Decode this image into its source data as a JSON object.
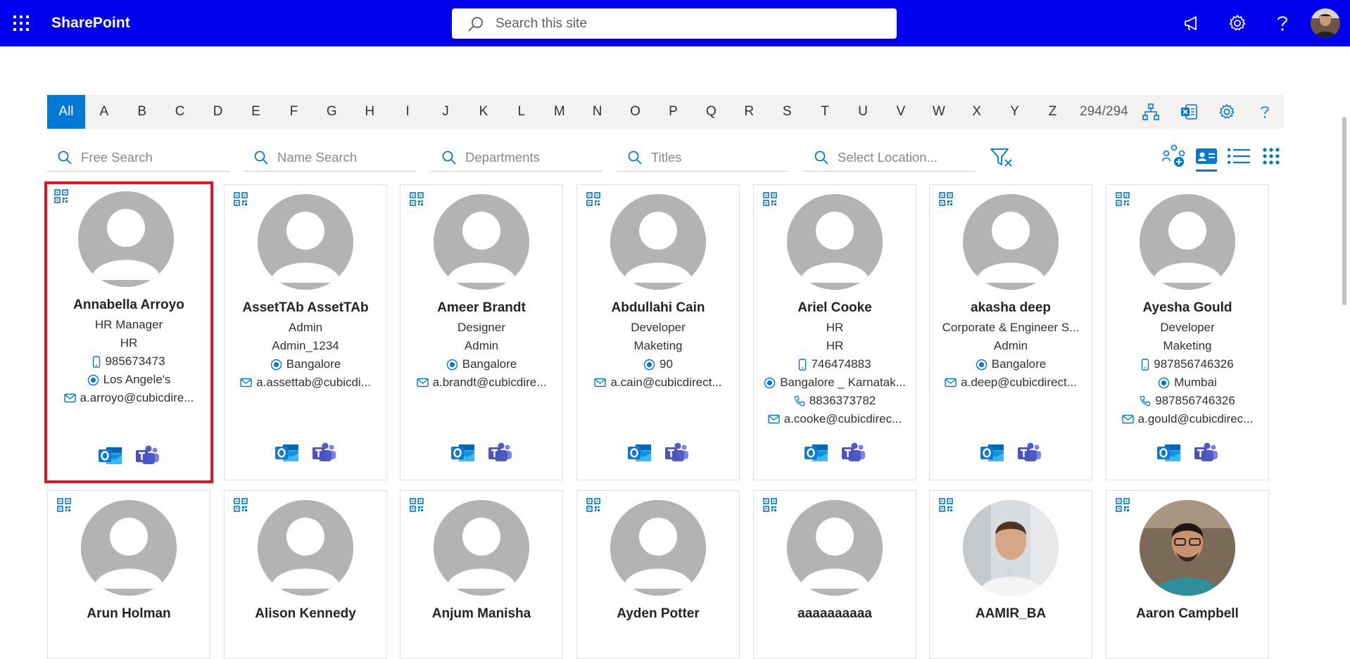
{
  "suite": {
    "brand": "SharePoint",
    "search_placeholder": "Search this site",
    "icons": [
      "waffle-icon",
      "megaphone-icon",
      "gear-icon",
      "help-icon"
    ]
  },
  "alphabet": {
    "letters": [
      "All",
      "A",
      "B",
      "C",
      "D",
      "E",
      "F",
      "G",
      "H",
      "I",
      "J",
      "K",
      "L",
      "M",
      "N",
      "O",
      "P",
      "Q",
      "R",
      "S",
      "T",
      "U",
      "V",
      "W",
      "X",
      "Y",
      "Z"
    ],
    "active": "All",
    "count": "294/294"
  },
  "filters": {
    "free": "Free Search",
    "name": "Name Search",
    "departments": "Departments",
    "titles": "Titles",
    "location": "Select Location..."
  },
  "cards": [
    {
      "name": "Annabella Arroyo",
      "title": "HR Manager",
      "dept": "HR",
      "mobile": "985673473",
      "location": "Los Angele's",
      "email": "a.arroyo@cubicdire...",
      "selected": true
    },
    {
      "name": "AssetTAb AssetTAb",
      "title": "Admin",
      "dept": "Admin_1234",
      "location": "Bangalore",
      "email": "a.assettab@cubicdi..."
    },
    {
      "name": "Ameer Brandt",
      "title": "Designer",
      "dept": "Admin",
      "location": "Bangalore",
      "email": "a.brandt@cubicdire..."
    },
    {
      "name": "Abdullahi Cain",
      "title": "Developer",
      "dept": "Maketing",
      "location": "90",
      "email": "a.cain@cubicdirect..."
    },
    {
      "name": "Ariel Cooke",
      "title": "HR",
      "dept": "HR",
      "mobile": "746474883",
      "location": "Bangalore _ Karnatak...",
      "phone": "8836373782",
      "email": "a.cooke@cubicdirec..."
    },
    {
      "name": "akasha deep",
      "title": "Corporate & Engineer S...",
      "dept": "Admin",
      "location": "Bangalore",
      "email": "a.deep@cubicdirect..."
    },
    {
      "name": "Ayesha Gould",
      "title": "Developer",
      "dept": "Maketing",
      "mobile": "987856746326",
      "location": "Mumbai",
      "phone": "987856746326",
      "email": "a.gould@cubicdirec..."
    },
    {
      "name": "Arun Holman",
      "photo": "default"
    },
    {
      "name": "Alison Kennedy",
      "photo": "default"
    },
    {
      "name": "Anjum Manisha",
      "photo": "default"
    },
    {
      "name": "Ayden Potter",
      "photo": "default"
    },
    {
      "name": "aaaaaaaaaa",
      "photo": "default"
    },
    {
      "name": "AAMIR_BA",
      "photo": "photo-man-white-shirt"
    },
    {
      "name": "Aaron Campbell",
      "photo": "photo-man-glasses"
    }
  ]
}
